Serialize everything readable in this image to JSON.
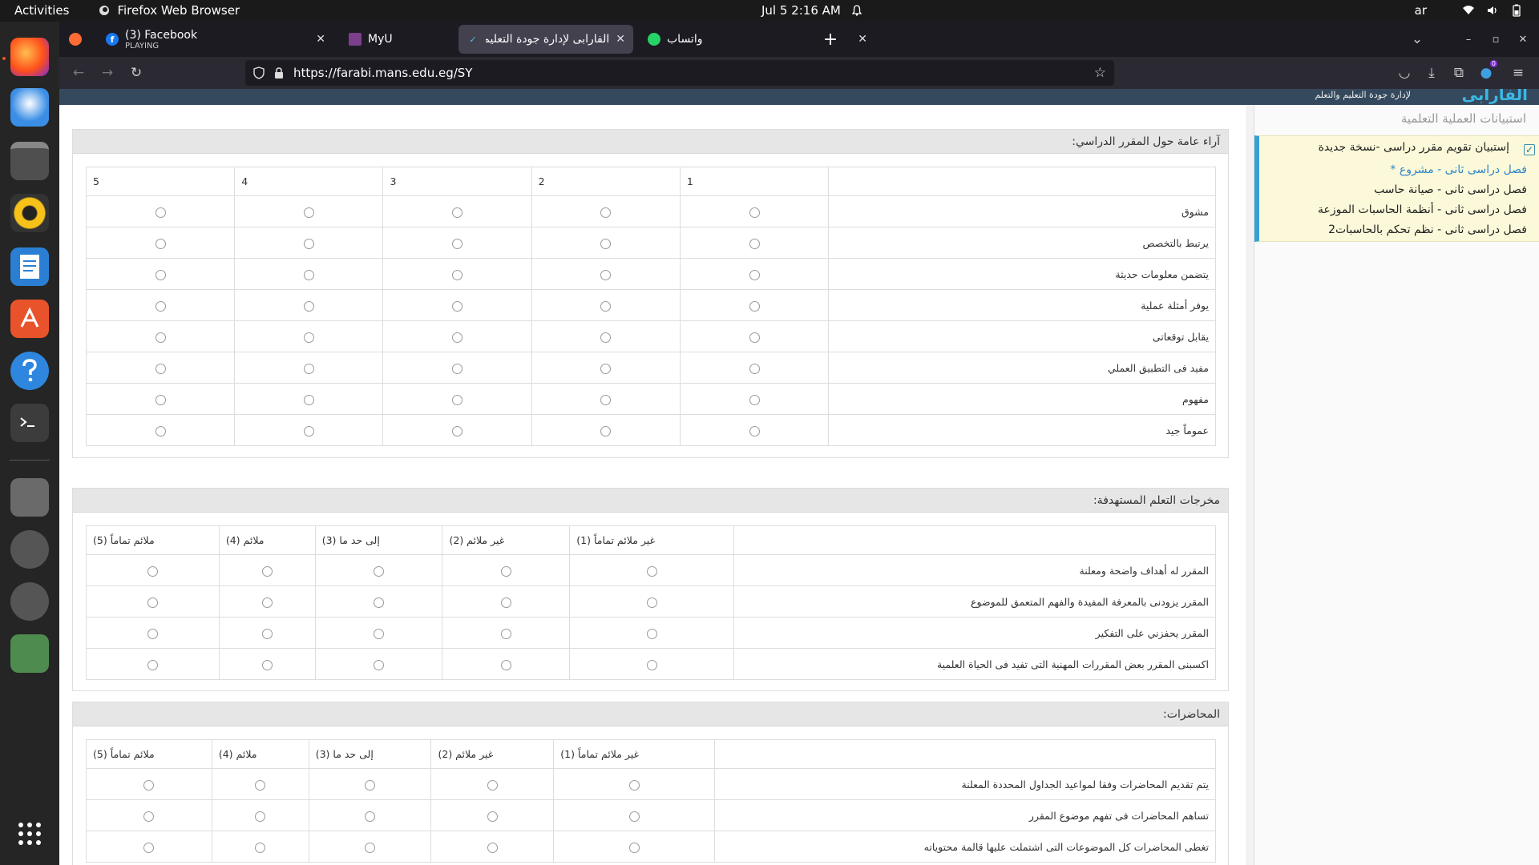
{
  "topbar": {
    "activities": "Activities",
    "app_name": "Firefox Web Browser",
    "clock": "Jul 5  2:16 AM",
    "lang": "ar"
  },
  "browser": {
    "tabs": [
      {
        "title": "(3) Facebook",
        "subtitle": "PLAYING",
        "favicon": "facebook-icon"
      },
      {
        "title": "MyU",
        "favicon": "myu-icon"
      },
      {
        "title": "الفارابى لإدارة جودة التعليم",
        "favicon": "farabi-icon",
        "active": true
      },
      {
        "title": "واتساب",
        "favicon": "whatsapp-icon"
      }
    ],
    "url": "https://farabi.mans.edu.eg/SY",
    "downloads_badge": "0"
  },
  "site": {
    "logo": "الفارابى",
    "logo_sub": "لإدارة جودة التعليم والتعلم"
  },
  "sidebar": {
    "title": "استبيانات العملية التعلمية",
    "items": [
      {
        "label": "إستبيان تقويم مقرر دراسى -نسخة جديدة"
      },
      {
        "label": "فصل دراسى ثانى - مشروع *",
        "selected": true
      },
      {
        "label": "فصل دراسى ثانى - صيانة حاسب"
      },
      {
        "label": "فصل دراسى ثانى - أنظمة الحاسبات الموزعة"
      },
      {
        "label": "فصل دراسى ثانى - نظم تحكم بالحاسبات2"
      }
    ]
  },
  "sections": [
    {
      "title": "آراء عامة حول المقرر الدراسي:",
      "columns": [
        "1",
        "2",
        "3",
        "4",
        "5"
      ],
      "rows": [
        "مشوق",
        "يرتبط بالتخصص",
        "يتضمن معلومات حديثة",
        "يوفر أمثلة عملية",
        "يقابل توقعاتى",
        "مفيد فى التطبيق العملي",
        "مفهوم",
        "عموماً جيد"
      ]
    },
    {
      "title": "مخرجات التعلم المستهدفة:",
      "columns": [
        "غير ملائم تماماً (1)",
        "غير ملائم (2)",
        "إلى حد ما (3)",
        "ملائم (4)",
        "ملائم تماماً (5)"
      ],
      "rows": [
        "المقرر له أهداف واضحة ومعلنة",
        "المقرر يزودنى بالمعرفة المفيدة والفهم المتعمق للموضوع",
        "المقرر يحفزني على التفكير",
        "اكسبنى المقرر بعض المقررات المهنية التى تفيد فى الحياة العلمية"
      ]
    },
    {
      "title": "المحاضرات:",
      "columns": [
        "غير ملائم تماماً (1)",
        "غير ملائم (2)",
        "إلى حد ما (3)",
        "ملائم (4)",
        "ملائم تماماً (5)"
      ],
      "rows": [
        "يتم تقديم المحاضرات وفقا لمواعيد الجداول المحددة المعلنة",
        "تساهم المحاضرات فى تفهم موضوع المقرر",
        "تغطى المحاضرات كل الموضوعات التى اشتملت عليها قالمة محتوياته"
      ]
    }
  ],
  "colors": {
    "accent": "#3a9fd1",
    "sidebar_highlight": "#fbf9d9",
    "link": "#2f86c9"
  }
}
